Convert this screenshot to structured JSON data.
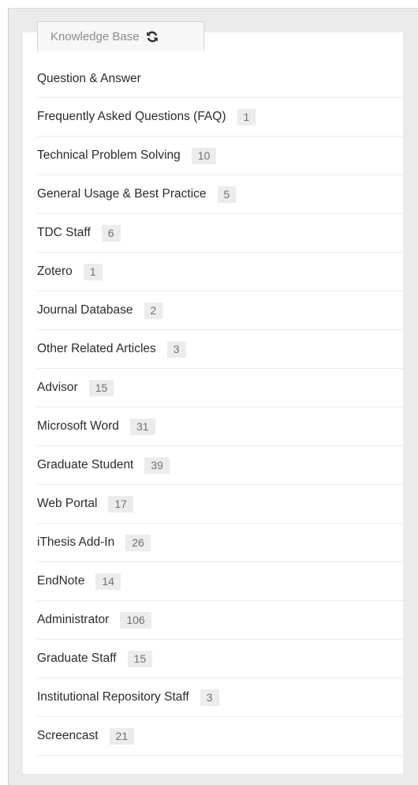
{
  "widget": {
    "title": "Knowledge Base",
    "refresh_icon": "refresh-icon"
  },
  "categories": [
    {
      "label": "Question & Answer",
      "count": ""
    },
    {
      "label": "Frequently Asked Questions (FAQ)",
      "count": "1"
    },
    {
      "label": "Technical Problem Solving",
      "count": "10"
    },
    {
      "label": "General Usage & Best Practice",
      "count": "5"
    },
    {
      "label": "TDC Staff",
      "count": "6"
    },
    {
      "label": "Zotero",
      "count": "1"
    },
    {
      "label": "Journal Database",
      "count": "2"
    },
    {
      "label": "Other Related Articles",
      "count": "3"
    },
    {
      "label": "Advisor",
      "count": "15"
    },
    {
      "label": "Microsoft Word",
      "count": "31"
    },
    {
      "label": "Graduate Student",
      "count": "39"
    },
    {
      "label": "Web Portal",
      "count": "17"
    },
    {
      "label": "iThesis Add-In",
      "count": "26"
    },
    {
      "label": "EndNote",
      "count": "14"
    },
    {
      "label": "Administrator",
      "count": "106"
    },
    {
      "label": "Graduate Staff",
      "count": "15"
    },
    {
      "label": "Institutional Repository Staff",
      "count": "3"
    },
    {
      "label": "Screencast",
      "count": "21"
    }
  ]
}
